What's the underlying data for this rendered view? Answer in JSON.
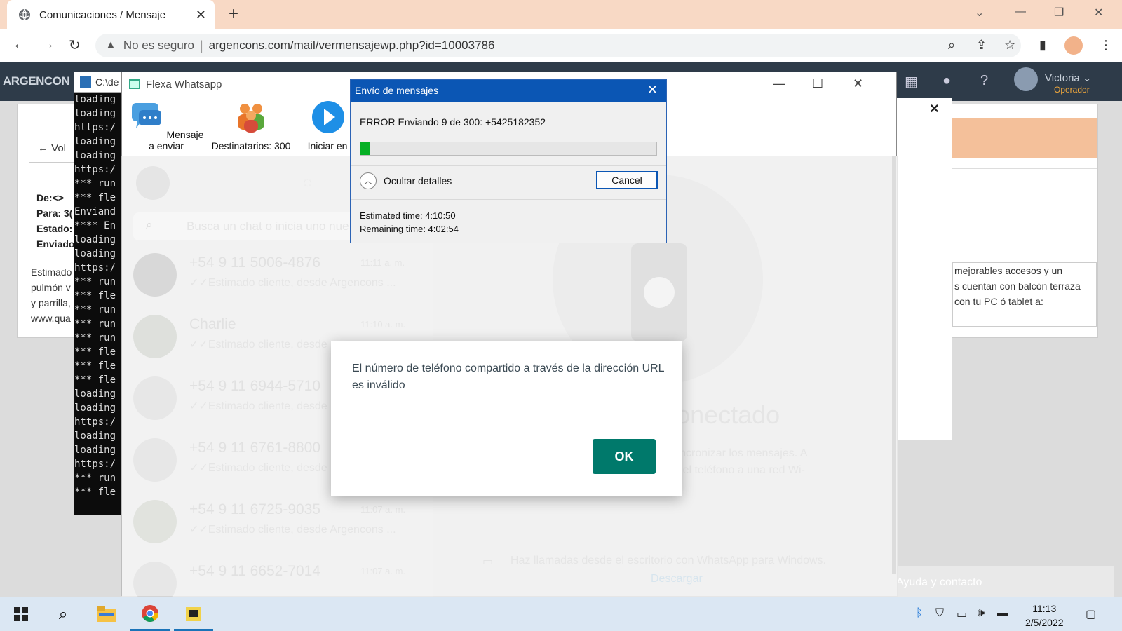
{
  "browser": {
    "tab_title": "Comunicaciones / Mensaje",
    "insecure_label": "No es seguro",
    "url": "argencons.com/mail/vermensajewp.php?id=10003786"
  },
  "page": {
    "brand": "ARGENCON",
    "back_label": "← Vol",
    "meta": [
      "De:<>",
      "Para: 3(",
      "Estado:",
      "Enviado"
    ],
    "left_text": "Estimado\npulmón v\ny parrilla,\nwww.qua",
    "right_text": "mejorables accesos y un\ns cuentan con balcón terraza\ncon tu PC ó tablet a:",
    "user_name": "Victoria ⌄",
    "user_role": "Operador",
    "modal_close": "×",
    "help_label": "Ayuda y contacto"
  },
  "console": {
    "title": "C:\\de",
    "lines": "loading\nloading\nhttps:/\nloading\nloading\nhttps:/\n*** run\n*** fle\nEnviand\n**** En\nloading\nloading\nhttps:/\n*** run\n*** fle\n*** run\n*** run\n*** run\n*** fle\n*** fle\n*** fle\nloading\nloading\nhttps:/\nloading\nloading\nhttps:/\n*** run\n*** fle"
  },
  "flexa": {
    "title": "Flexa Whatsapp",
    "ribbon": [
      {
        "label": "Mensaje a enviar",
        "icon": "message-bubbles-icon"
      },
      {
        "label": "Destinatarios: 300",
        "icon": "people-icon"
      },
      {
        "label": "Iniciar en",
        "icon": "play-icon"
      }
    ]
  },
  "whatsapp": {
    "search_placeholder": "Busca un chat o inicia uno nue",
    "chats": [
      {
        "name": "+54 9 11 5006-4876",
        "time": "11:11 a. m.",
        "preview": "✓✓Estimado cliente, desde Argencons ..."
      },
      {
        "name": "Charlie",
        "time": "11:10 a. m.",
        "preview": "✓✓Estimado cliente, desde"
      },
      {
        "name": "+54 9 11 6944-5710",
        "time": "",
        "preview": "✓✓Estimado cliente, desde"
      },
      {
        "name": "+54 9 11 6761-8800",
        "time": "",
        "preview": "✓✓Estimado cliente, desde"
      },
      {
        "name": "+54 9 11 6725-9035",
        "time": "11:07 a. m.",
        "preview": "✓✓Estimado cliente, desde Argencons ..."
      },
      {
        "name": "+54 9 11 6652-7014",
        "time": "11:07 a. m.",
        "preview": ""
      }
    ],
    "big_status": "no conectado",
    "small_text": "ara sincronizar los mensajes. A\nnecta el teléfono a una red Wi-",
    "calls_text": "Haz llamadas desde el escritorio con WhatsApp para Windows.",
    "download_link": "Descargar"
  },
  "envio": {
    "title": "Envío de mensajes",
    "status": "ERROR Enviando 9 de 300: +5425182352",
    "progress": 0.03,
    "details_label": "Ocultar detalles",
    "cancel_label": "Cancel",
    "estimated": "Estimated time: 4:10:50",
    "remaining": "Remaining time: 4:02:54"
  },
  "alert": {
    "message": "El número de teléfono compartido a través de la dirección URL es inválido",
    "ok_label": "OK"
  },
  "taskbar": {
    "time": "11:13",
    "date": "2/5/2022"
  },
  "colors": {
    "chrome_tabstrip": "#f8d9c5",
    "dialog_title": "#0b56b4",
    "progress_fill": "#06b025",
    "whatsapp_ok": "#00796b",
    "page_header": "#2e3b49"
  }
}
